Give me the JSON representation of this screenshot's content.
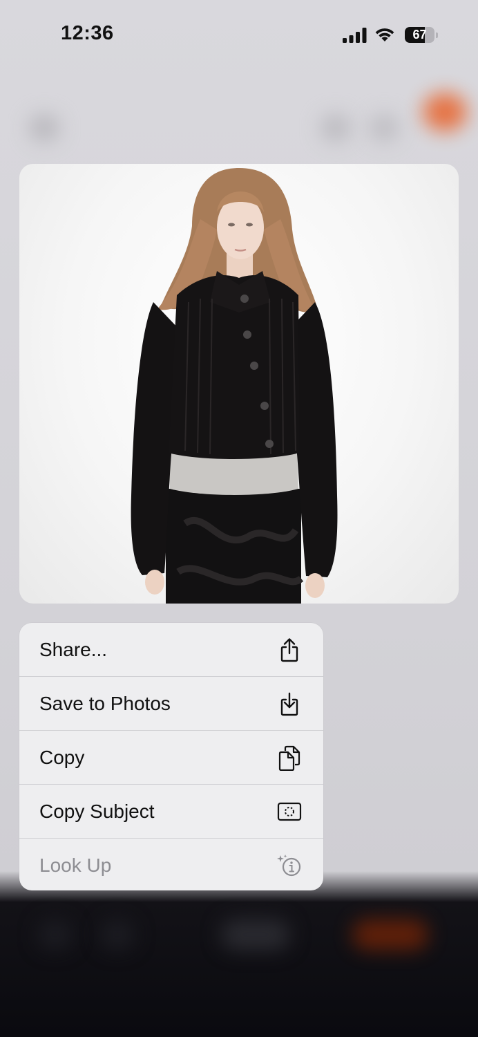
{
  "status_bar": {
    "time": "12:36",
    "battery": "67",
    "battery_level": 0.67,
    "icons": [
      "cellular-signal-icon",
      "wifi-icon",
      "battery-icon"
    ]
  },
  "preview": {
    "image": "photo-of-person-in-black-cropped-cardigan"
  },
  "menu": {
    "items": [
      {
        "label": "Share...",
        "icon": "share-icon",
        "enabled": true
      },
      {
        "label": "Save to Photos",
        "icon": "save-to-photos-icon",
        "enabled": true
      },
      {
        "label": "Copy",
        "icon": "copy-icon",
        "enabled": true
      },
      {
        "label": "Copy Subject",
        "icon": "copy-subject-icon",
        "enabled": true
      },
      {
        "label": "Look Up",
        "icon": "look-up-icon",
        "enabled": false
      }
    ]
  },
  "colors": {
    "menu_background": "#eeeef0",
    "disabled_text": "#8d8d92",
    "accent_blur": "#e8622a"
  }
}
